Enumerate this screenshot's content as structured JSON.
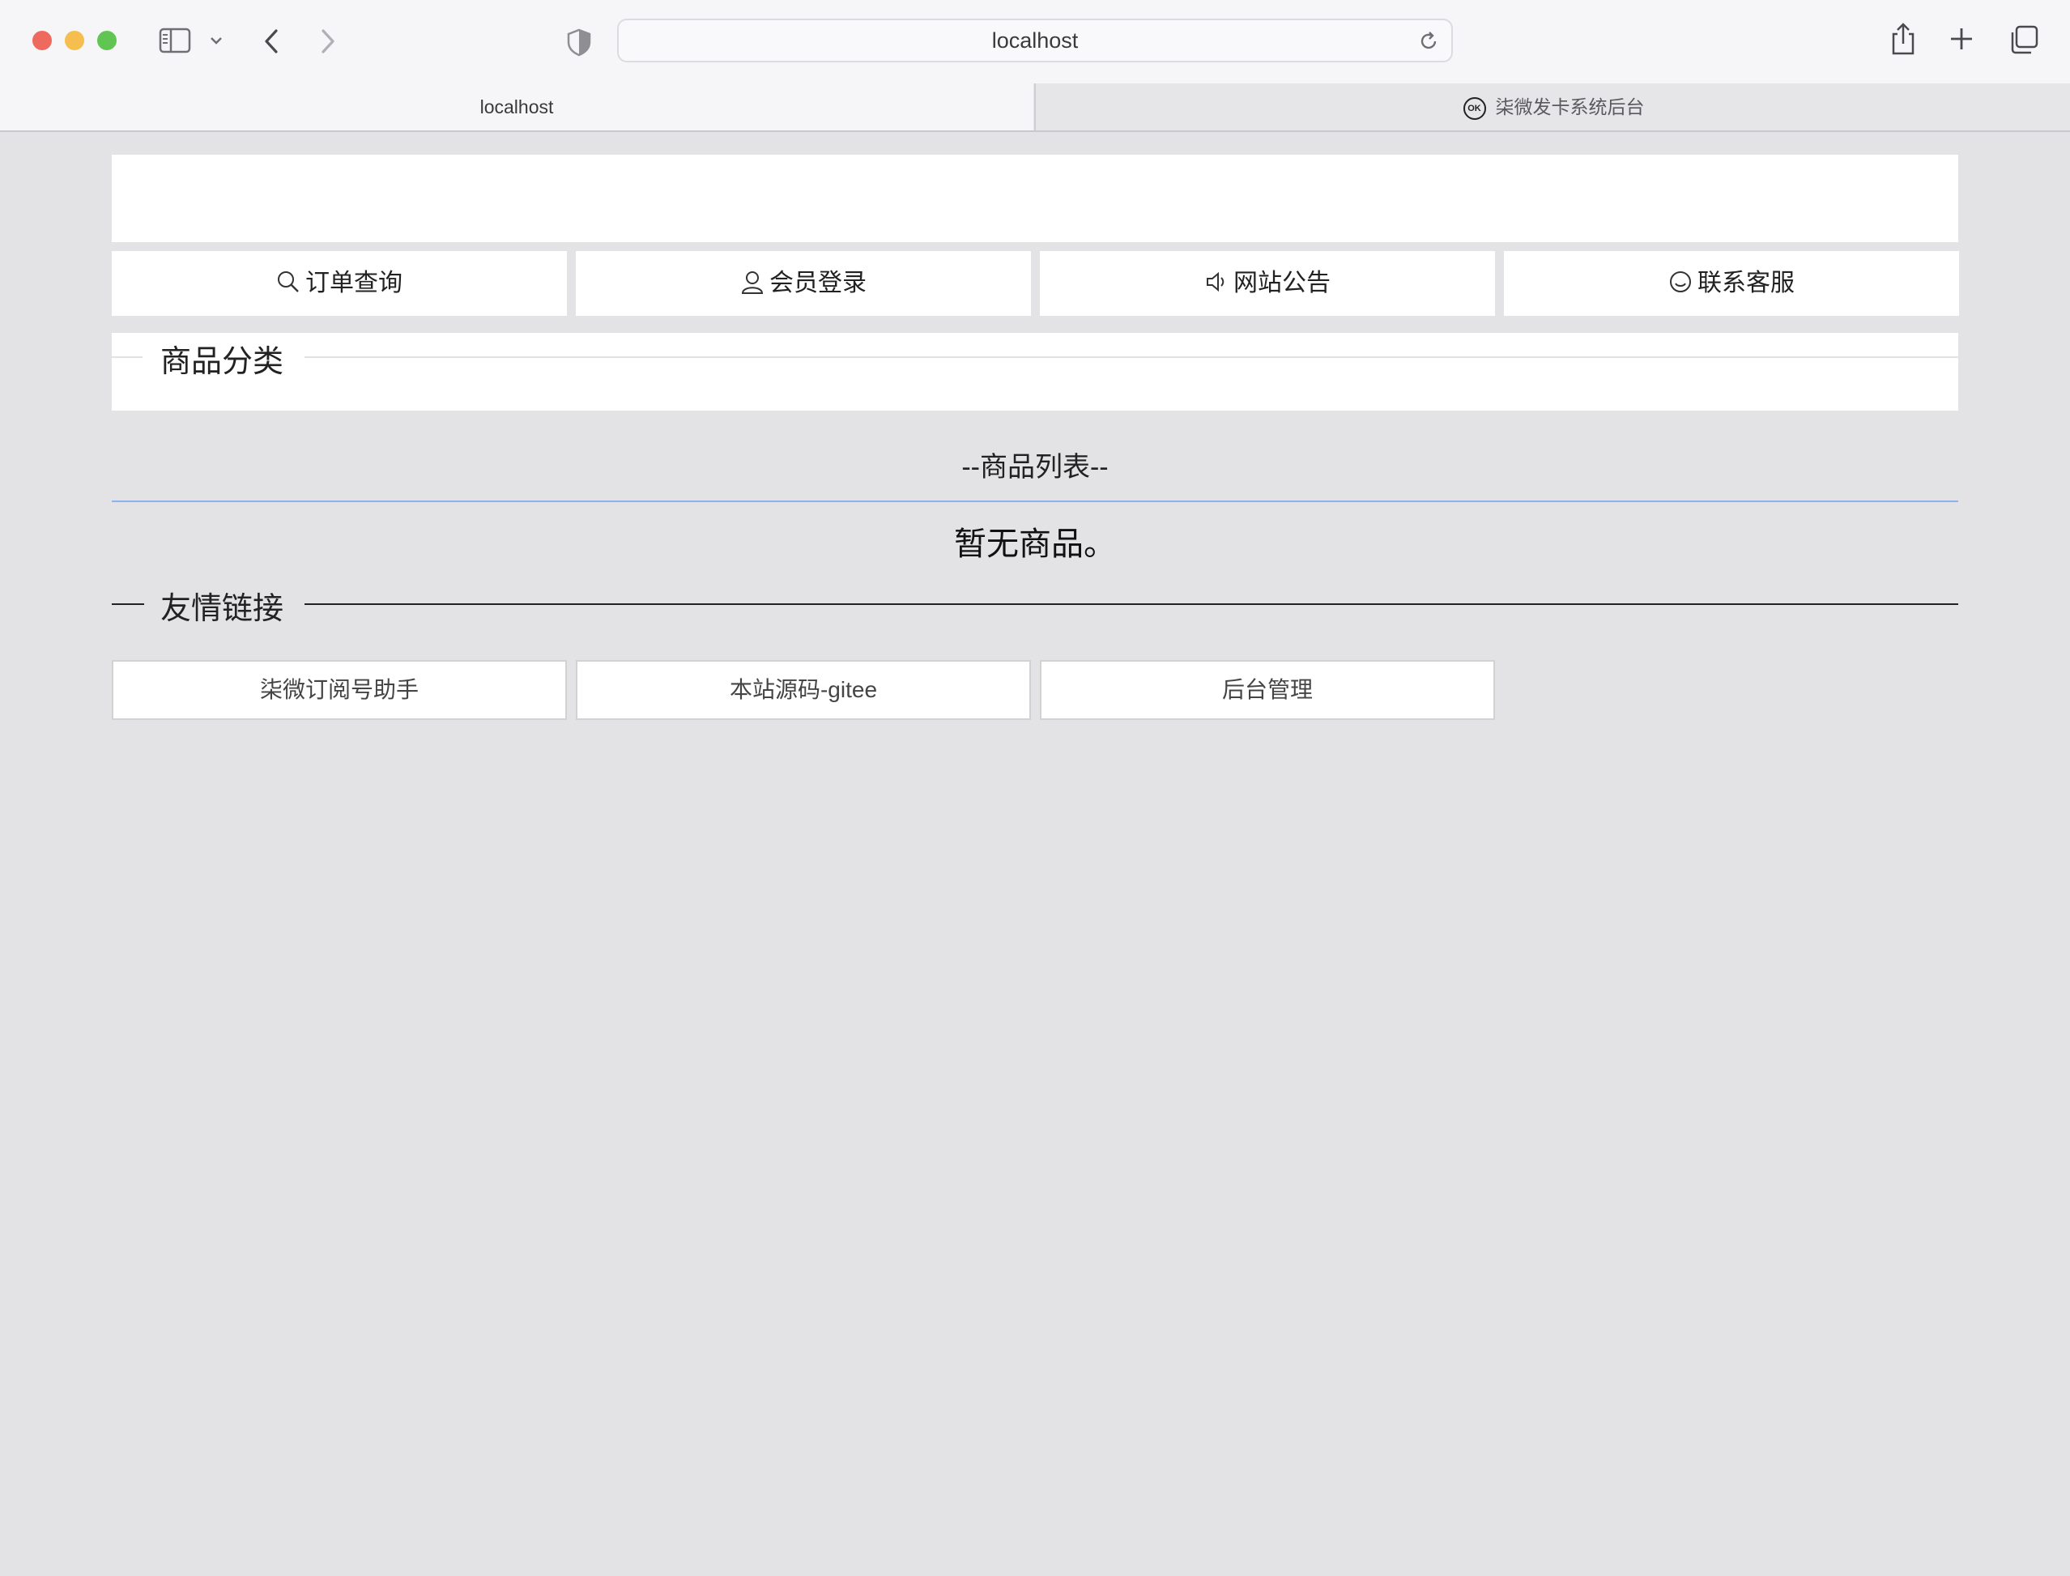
{
  "browser": {
    "url": "localhost",
    "tabs": [
      {
        "label": "localhost",
        "active": true
      },
      {
        "label": "柒微发卡系统后台",
        "active": false,
        "favicon_text": "OK"
      }
    ]
  },
  "nav": {
    "items": [
      {
        "label": "订单查询",
        "icon": "search-icon"
      },
      {
        "label": "会员登录",
        "icon": "user-icon"
      },
      {
        "label": "网站公告",
        "icon": "speaker-icon"
      },
      {
        "label": "联系客服",
        "icon": "smile-icon"
      }
    ]
  },
  "category": {
    "title": "商品分类"
  },
  "product_list": {
    "title": "--商品列表--",
    "empty_text": "暂无商品。"
  },
  "friend_links": {
    "title": "友情链接",
    "items": [
      {
        "label": "柒微订阅号助手"
      },
      {
        "label": "本站源码-gitee"
      },
      {
        "label": "后台管理"
      }
    ]
  },
  "colors": {
    "page_bg": "#e3e2e5",
    "accent_rule": "#8fb1f0"
  }
}
